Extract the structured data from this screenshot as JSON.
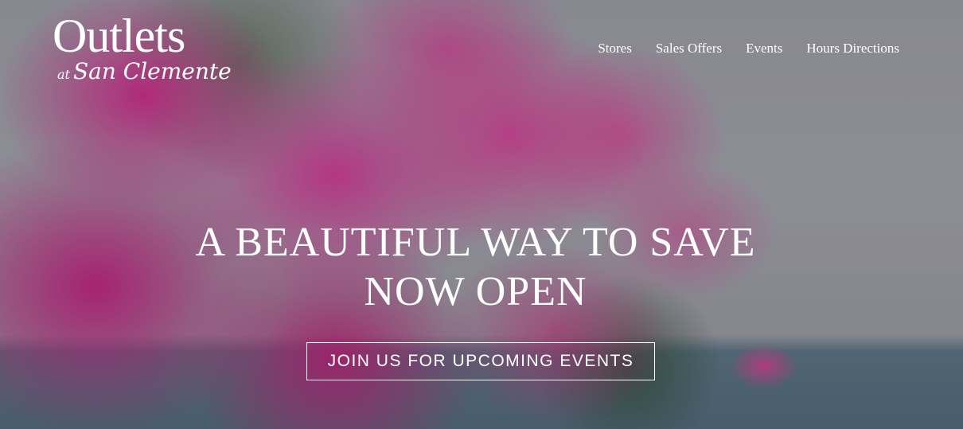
{
  "logo": {
    "main": "Outlets",
    "at": "at",
    "location": "San Clemente"
  },
  "nav": {
    "items": [
      {
        "label": "Stores"
      },
      {
        "label": "Sales Offers"
      },
      {
        "label": "Events"
      },
      {
        "label": "Hours Directions"
      }
    ]
  },
  "hero": {
    "headline_line1": "A BEAUTIFUL WAY TO SAVE",
    "headline_line2": "NOW OPEN",
    "cta_label": "JOIN US FOR UPCOMING EVENTS"
  },
  "colors": {
    "text": "#ffffff",
    "accent_flowers": "#d22f96"
  }
}
